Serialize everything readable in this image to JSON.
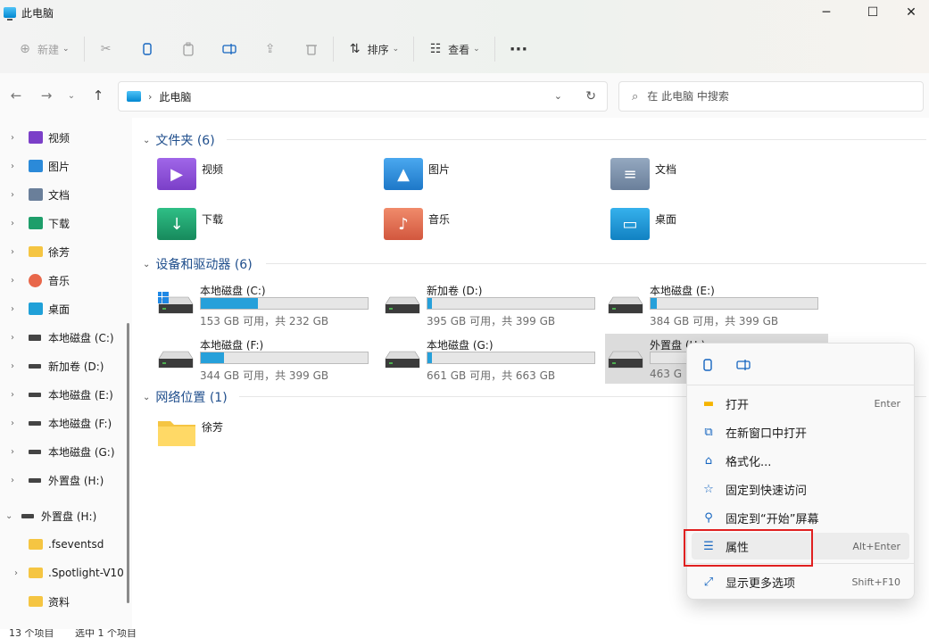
{
  "window": {
    "title": "此电脑",
    "minimize": "─",
    "maximize": "☐",
    "close": "✕"
  },
  "toolbar": {
    "new_label": "新建",
    "sort_label": "排序",
    "view_label": "查看",
    "more_label": "···"
  },
  "address": {
    "crumb": "此电脑"
  },
  "search": {
    "placeholder": "在 此电脑 中搜索"
  },
  "sidebar": {
    "items": [
      {
        "label": "视频",
        "icon": "video-icon",
        "color": "#7b3fc8"
      },
      {
        "label": "图片",
        "icon": "pictures-icon",
        "color": "#2b8ad9"
      },
      {
        "label": "文档",
        "icon": "documents-icon",
        "color": "#6a7f9a"
      },
      {
        "label": "下载",
        "icon": "downloads-icon",
        "color": "#1e9e6a"
      },
      {
        "label": "徐芳",
        "icon": "folder-icon",
        "color": "#f5c542"
      },
      {
        "label": "音乐",
        "icon": "music-icon",
        "color": "#e8674a"
      },
      {
        "label": "桌面",
        "icon": "desktop-icon",
        "color": "#1fa0d8"
      },
      {
        "label": "本地磁盘 (C:)",
        "icon": "drive-c-icon",
        "color": "#444444"
      },
      {
        "label": "新加卷 (D:)",
        "icon": "drive-icon",
        "color": "#444444"
      },
      {
        "label": "本地磁盘 (E:)",
        "icon": "drive-icon",
        "color": "#444444"
      },
      {
        "label": "本地磁盘 (F:)",
        "icon": "drive-icon",
        "color": "#444444"
      },
      {
        "label": "本地磁盘 (G:)",
        "icon": "drive-icon",
        "color": "#444444"
      },
      {
        "label": "外置盘 (H:)",
        "icon": "drive-icon",
        "color": "#444444"
      },
      {
        "label": "外置盘 (H:)",
        "icon": "drive-icon",
        "color": "#444444"
      },
      {
        "label": ".fseventsd",
        "icon": "folder-icon",
        "color": "#f5c542"
      },
      {
        "label": ".Spotlight-V10",
        "icon": "folder-icon",
        "color": "#f5c542"
      },
      {
        "label": "资料",
        "icon": "folder-icon",
        "color": "#f5c542"
      }
    ]
  },
  "groups": {
    "folders": "文件夹 (6)",
    "drives": "设备和驱动器 (6)",
    "network": "网络位置 (1)"
  },
  "folders": [
    {
      "label": "视频",
      "icon": "videos-folder-icon"
    },
    {
      "label": "图片",
      "icon": "pictures-folder-icon"
    },
    {
      "label": "文档",
      "icon": "documents-folder-icon"
    },
    {
      "label": "下载",
      "icon": "downloads-folder-icon"
    },
    {
      "label": "音乐",
      "icon": "music-folder-icon"
    },
    {
      "label": "桌面",
      "icon": "desktop-folder-icon"
    }
  ],
  "drives": [
    {
      "name": "本地磁盘 (C:)",
      "free": "153 GB 可用，共 232 GB",
      "used_fraction": 0.34
    },
    {
      "name": "新加卷 (D:)",
      "free": "395 GB 可用，共 399 GB",
      "used_fraction": 0.01
    },
    {
      "name": "本地磁盘 (E:)",
      "free": "384 GB 可用，共 399 GB",
      "used_fraction": 0.04
    },
    {
      "name": "本地磁盘 (F:)",
      "free": "344 GB 可用，共 399 GB",
      "used_fraction": 0.14
    },
    {
      "name": "本地磁盘 (G:)",
      "free": "661 GB 可用，共 663 GB",
      "used_fraction": 0.003
    },
    {
      "name": "外置盘 (H:)",
      "free": "463 G",
      "used_fraction": 0.0
    }
  ],
  "network": [
    {
      "label": "徐芳"
    }
  ],
  "context_menu": {
    "items": [
      {
        "label": "打开",
        "shortcut": "Enter",
        "icon": "open-icon"
      },
      {
        "label": "在新窗口中打开",
        "shortcut": "",
        "icon": "open-new-window-icon"
      },
      {
        "label": "格式化...",
        "shortcut": "",
        "icon": "format-icon"
      },
      {
        "label": "固定到快速访问",
        "shortcut": "",
        "icon": "star-icon"
      },
      {
        "label": "固定到“开始”屏幕",
        "shortcut": "",
        "icon": "pin-icon"
      },
      {
        "label": "属性",
        "shortcut": "Alt+Enter",
        "icon": "properties-icon"
      },
      {
        "label": "显示更多选项",
        "shortcut": "Shift+F10",
        "icon": "more-options-icon"
      }
    ]
  },
  "status": {
    "count": "13 个项目",
    "selected": "选中 1 个项目"
  }
}
